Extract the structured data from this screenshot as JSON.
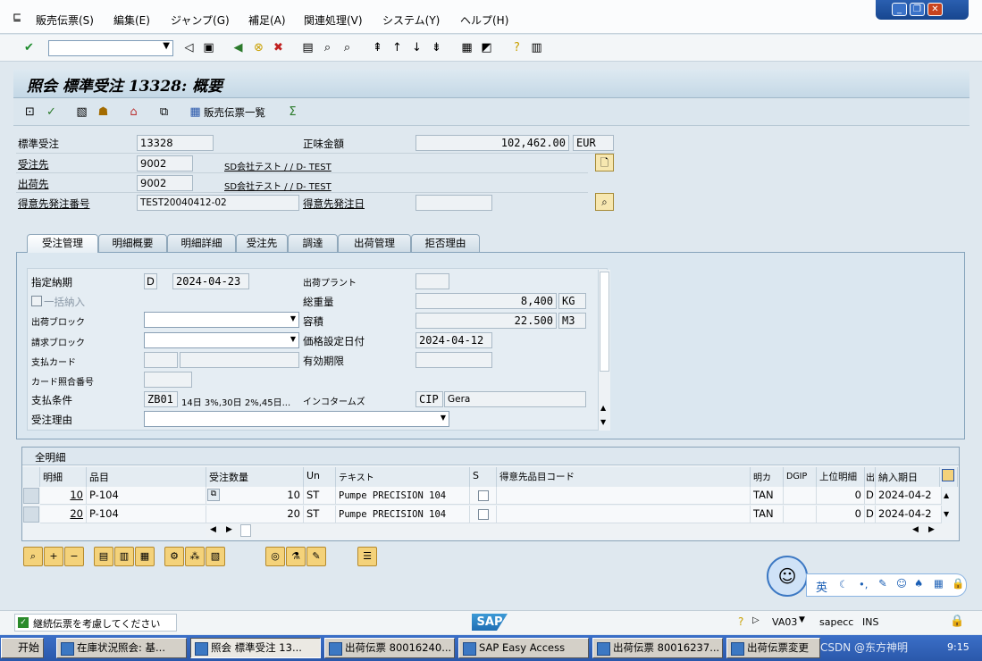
{
  "menu": [
    "販売伝票(S)",
    "編集(E)",
    "ジャンプ(G)",
    "補足(A)",
    "関連処理(V)",
    "システム(Y)",
    "ヘルプ(H)"
  ],
  "window_controls": {
    "minimize": "_",
    "restore": "❐",
    "close": "✕"
  },
  "title": "照会 標準受注 13328: 概要",
  "app_toolbar": {
    "list_button": "販売伝票一覧"
  },
  "header": {
    "order_type_label": "標準受注",
    "order_no": "13328",
    "net_value_label": "正味金額",
    "net_value": "102,462.00",
    "currency": "EUR",
    "sold_to_label": "受注先",
    "sold_to": "9002",
    "sold_to_name": "SD会社テスト / / D- TEST",
    "ship_to_label": "出荷先",
    "ship_to": "9002",
    "ship_to_name": "SD会社テスト / / D- TEST",
    "po_no_label": "得意先発注番号",
    "po_no": "TEST20040412-02",
    "po_date_label": "得意先発注日",
    "po_date": ""
  },
  "tabs": [
    "受注管理",
    "明細概要",
    "明細詳細",
    "受注先",
    "調達",
    "出荷管理",
    "拒否理由"
  ],
  "sales_tab": {
    "req_delivery_label": "指定納期",
    "req_delivery_type": "D",
    "req_delivery_date": "2024-04-23",
    "plant_label": "出荷プラント",
    "plant": "",
    "complete_delivery_label": "一括納入",
    "total_weight_label": "総重量",
    "total_weight": "8,400",
    "weight_unit": "KG",
    "delivery_block_label": "出荷ブロック",
    "volume_label": "容積",
    "volume": "22.500",
    "volume_unit": "M3",
    "billing_block_label": "請求ブロック",
    "pricing_date_label": "価格設定日付",
    "pricing_date": "2024-04-12",
    "payment_card_label": "支払カード",
    "valid_to_label": "有効期限",
    "card_verif_label": "カード照合番号",
    "payment_terms_label": "支払条件",
    "payment_terms": "ZB01",
    "payment_terms_text": "14日 3%,30日 2%,45日...",
    "incoterms_label": "インコタームズ",
    "incoterms": "CIP",
    "incoterms_place": "Gera",
    "order_reason_label": "受注理由"
  },
  "items_table": {
    "title": "全明細",
    "columns": [
      "明細",
      "品目",
      "受注数量",
      "Un",
      "テキスト",
      "S",
      "得意先品目コード",
      "明カ",
      "DGIP",
      "上位明細",
      "出",
      "納入期日"
    ],
    "rows": [
      {
        "item": "10",
        "material": "P-104",
        "qty": "10",
        "unit": "ST",
        "text": "Pumpe PRECISION 104",
        "cat": "TAN",
        "higher": "0",
        "d": "D",
        "date": "2024-04-2"
      },
      {
        "item": "20",
        "material": "P-104",
        "qty": "20",
        "unit": "ST",
        "text": "Pumpe PRECISION 104",
        "cat": "TAN",
        "higher": "0",
        "d": "D",
        "date": "2024-04-2"
      }
    ]
  },
  "status": {
    "message": "継続伝票を考慮してください",
    "logo": "SAP",
    "tcode": "VA03",
    "server": "sapecc",
    "mode": "INS"
  },
  "taskbar": {
    "start": "开始",
    "tasks": [
      "在庫状況照会: 基...",
      "照会 標準受注 13...",
      "出荷伝票 80016240...",
      "SAP Easy Access",
      "出荷伝票 80016237...",
      "出荷伝票変更"
    ],
    "watermark": "CSDN @东方神明",
    "clock": "9:15"
  },
  "ime": {
    "lang": "英"
  },
  "colors": {
    "accent": "#2a58ab",
    "title_bg": "#c4d8e6",
    "field_bg": "#eef2f5"
  }
}
